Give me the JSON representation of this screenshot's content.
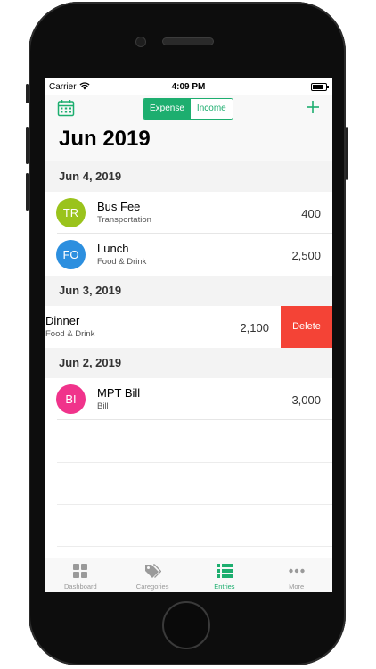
{
  "status_bar": {
    "carrier": "Carrier",
    "time": "4:09 PM"
  },
  "nav": {
    "segments": [
      {
        "label": "Expense",
        "active": true
      },
      {
        "label": "Income",
        "active": false
      }
    ],
    "title": "Jun 2019"
  },
  "sections": [
    {
      "date": "Jun 4, 2019",
      "entries": [
        {
          "initials": "TR",
          "title": "Bus Fee",
          "category": "Transportation",
          "amount": "400",
          "color": "#9ac31c"
        },
        {
          "initials": "FO",
          "title": "Lunch",
          "category": "Food & Drink",
          "amount": "2,500",
          "color": "#2c8fdf"
        }
      ]
    },
    {
      "date": "Jun 3, 2019",
      "entries": [
        {
          "title": "Dinner",
          "category": "Food & Drink",
          "amount": "2,100",
          "action": "Delete"
        }
      ]
    },
    {
      "date": "Jun 2, 2019",
      "entries": [
        {
          "initials": "BI",
          "title": "MPT Bill",
          "category": "Bill",
          "amount": "3,000",
          "color": "#f0338b"
        }
      ]
    }
  ],
  "tabs": [
    {
      "label": "Dashboard",
      "icon": "dashboard-grid-icon",
      "active": false
    },
    {
      "label": "Caregories",
      "icon": "tags-icon",
      "active": false
    },
    {
      "label": "Entries",
      "icon": "list-icon",
      "active": true
    },
    {
      "label": "More",
      "icon": "more-dots-icon",
      "active": false
    }
  ],
  "colors": {
    "accent": "#1dae6f",
    "delete": "#f44336"
  }
}
